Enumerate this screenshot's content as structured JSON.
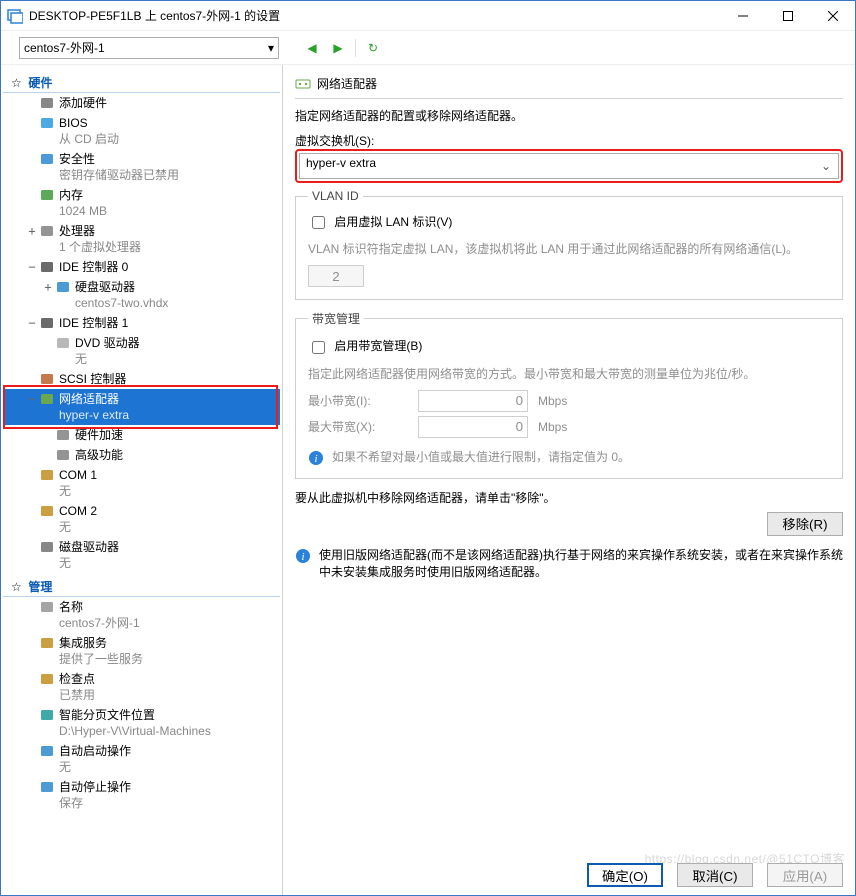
{
  "window": {
    "title": "DESKTOP-PE5F1LB 上 centos7-外网-1 的设置"
  },
  "toolbar": {
    "vm_selector": "centos7-外网-1"
  },
  "sidebar": {
    "hardware_header": "硬件",
    "management_header": "管理",
    "items": [
      {
        "exp": "",
        "icon": "add-hardware-icon",
        "main": "添加硬件",
        "sub": "",
        "indent": 1
      },
      {
        "exp": "",
        "icon": "bios-icon",
        "main": "BIOS",
        "sub": "从 CD 启动",
        "indent": 1
      },
      {
        "exp": "",
        "icon": "shield-icon",
        "main": "安全性",
        "sub": "密钥存储驱动器已禁用",
        "indent": 1
      },
      {
        "exp": "",
        "icon": "memory-icon",
        "main": "内存",
        "sub": "1024 MB",
        "indent": 1
      },
      {
        "exp": "+",
        "icon": "cpu-icon",
        "main": "处理器",
        "sub": "1 个虚拟处理器",
        "indent": 1
      },
      {
        "exp": "−",
        "icon": "ide-icon",
        "main": "IDE 控制器 0",
        "sub": "",
        "indent": 1
      },
      {
        "exp": "+",
        "icon": "hdd-icon",
        "main": "硬盘驱动器",
        "sub": "centos7-two.vhdx",
        "indent": 2
      },
      {
        "exp": "−",
        "icon": "ide-icon",
        "main": "IDE 控制器 1",
        "sub": "",
        "indent": 1
      },
      {
        "exp": "",
        "icon": "dvd-icon",
        "main": "DVD 驱动器",
        "sub": "无",
        "indent": 2
      },
      {
        "exp": "",
        "icon": "scsi-icon",
        "main": "SCSI 控制器",
        "sub": "",
        "indent": 1
      },
      {
        "exp": "−",
        "icon": "nic-icon",
        "main": "网络适配器",
        "sub": "hyper-v extra",
        "indent": 1,
        "selected": true
      },
      {
        "exp": "",
        "icon": "accel-icon",
        "main": "硬件加速",
        "sub": "",
        "indent": 2
      },
      {
        "exp": "",
        "icon": "adv-icon",
        "main": "高级功能",
        "sub": "",
        "indent": 2
      },
      {
        "exp": "",
        "icon": "com-icon",
        "main": "COM 1",
        "sub": "无",
        "indent": 1
      },
      {
        "exp": "",
        "icon": "com-icon",
        "main": "COM 2",
        "sub": "无",
        "indent": 1
      },
      {
        "exp": "",
        "icon": "floppy-icon",
        "main": "磁盘驱动器",
        "sub": "无",
        "indent": 1
      }
    ],
    "mgmt_items": [
      {
        "icon": "name-icon",
        "main": "名称",
        "sub": "centos7-外网-1"
      },
      {
        "icon": "services-icon",
        "main": "集成服务",
        "sub": "提供了一些服务"
      },
      {
        "icon": "checkpoint-icon",
        "main": "检查点",
        "sub": "已禁用"
      },
      {
        "icon": "smartpaging-icon",
        "main": "智能分页文件位置",
        "sub": "D:\\Hyper-V\\Virtual-Machines"
      },
      {
        "icon": "autostart-icon",
        "main": "自动启动操作",
        "sub": "无"
      },
      {
        "icon": "autostop-icon",
        "main": "自动停止操作",
        "sub": "保存"
      }
    ]
  },
  "right": {
    "title": "网络适配器",
    "desc": "指定网络适配器的配置或移除网络适配器。",
    "vswitch": {
      "legend": "虚拟交换机(S):",
      "value": "hyper-v extra"
    },
    "vlan": {
      "legend": "VLAN ID",
      "chk_label": "启用虚拟 LAN 标识(V)",
      "help": "VLAN 标识符指定虚拟 LAN，该虚拟机将此 LAN 用于通过此网络适配器的所有网络通信(L)。",
      "value": "2"
    },
    "bandwidth": {
      "legend": "带宽管理",
      "chk_label": "启用带宽管理(B)",
      "help": "指定此网络适配器使用网络带宽的方式。最小带宽和最大带宽的测量单位为兆位/秒。",
      "min_label": "最小带宽(I):",
      "max_label": "最大带宽(X):",
      "min_value": "0",
      "max_value": "0",
      "unit": "Mbps",
      "tip": "如果不希望对最小值或最大值进行限制，请指定值为 0。"
    },
    "remove_desc": "要从此虚拟机中移除网络适配器，请单击\"移除\"。",
    "remove_btn": "移除(R)",
    "legacy_info": "使用旧版网络适配器(而不是该网络适配器)执行基于网络的来宾操作系统安装，或者在来宾操作系统中未安装集成服务时使用旧版网络适配器。"
  },
  "footer": {
    "ok": "确定(O)",
    "cancel": "取消(C)",
    "apply": "应用(A)"
  },
  "watermark": "https://blog.csdn.net/@51CTO博客"
}
